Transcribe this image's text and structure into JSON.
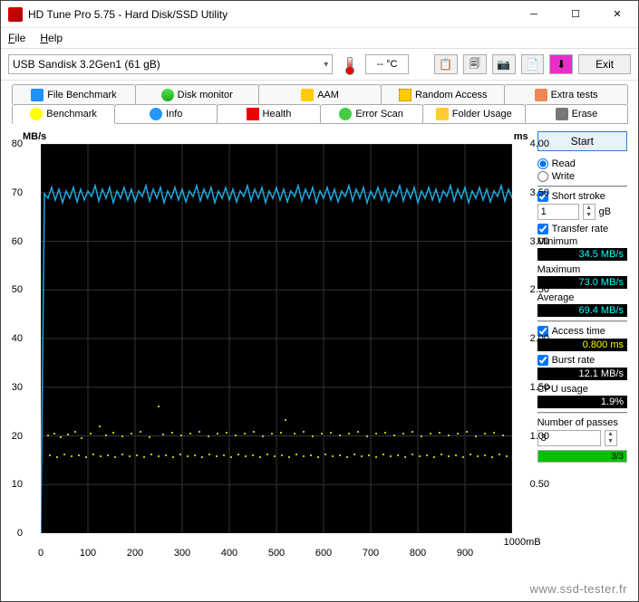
{
  "window": {
    "title": "HD Tune Pro 5.75 - Hard Disk/SSD Utility",
    "menus": [
      "File",
      "Help"
    ]
  },
  "toolbar": {
    "device": "USB Sandisk 3.2Gen1 (61 gB)",
    "temp": "-- °C",
    "exit": "Exit"
  },
  "tabs_top": [
    {
      "label": "File Benchmark"
    },
    {
      "label": "Disk monitor"
    },
    {
      "label": "AAM"
    },
    {
      "label": "Random Access"
    },
    {
      "label": "Extra tests"
    }
  ],
  "tabs_bottom": [
    {
      "label": "Benchmark"
    },
    {
      "label": "Info"
    },
    {
      "label": "Health"
    },
    {
      "label": "Error Scan"
    },
    {
      "label": "Folder Usage"
    },
    {
      "label": "Erase"
    }
  ],
  "chart_data": {
    "type": "line",
    "y_left": {
      "label": "MB/s",
      "min": 0,
      "max": 80,
      "ticks": [
        0,
        10,
        20,
        30,
        40,
        50,
        60,
        70,
        80
      ]
    },
    "y_right": {
      "label": "ms",
      "min": 0,
      "max": 4.0,
      "ticks": [
        "0.50",
        "1.00",
        "1.50",
        "2.00",
        "2.50",
        "3.00",
        "3.50",
        "4.00"
      ]
    },
    "x": {
      "min": 0,
      "max": 1000,
      "ticks": [
        0,
        100,
        200,
        300,
        400,
        500,
        600,
        700,
        800,
        900
      ],
      "unit": "mB"
    },
    "series": [
      {
        "name": "Transfer rate",
        "color": "#1ea8e0",
        "mean": 69.4,
        "min": 34.5,
        "max": 73.0,
        "notes": "oscillates ~67–73 MB/s with initial dip"
      },
      {
        "name": "Access time band 1",
        "color": "#ffff00",
        "approx_ms": 1.0,
        "style": "scatter"
      },
      {
        "name": "Access time band 2",
        "color": "#ffff00",
        "approx_ms": 0.8,
        "style": "scatter"
      }
    ]
  },
  "side": {
    "start": "Start",
    "read": "Read",
    "write": "Write",
    "short_stroke_label": "Short stroke",
    "short_stroke_value": "1",
    "short_stroke_unit": "gB",
    "transfer_rate_label": "Transfer rate",
    "minimum_label": "Minimum",
    "minimum_value": "34.5 MB/s",
    "maximum_label": "Maximum",
    "maximum_value": "73.0 MB/s",
    "average_label": "Average",
    "average_value": "69.4 MB/s",
    "access_time_label": "Access time",
    "access_time_value": "0.800 ms",
    "burst_rate_label": "Burst rate",
    "burst_rate_value": "12.1 MB/s",
    "cpu_usage_label": "CPU usage",
    "cpu_usage_value": "1.9%",
    "passes_label": "Number of passes",
    "passes_value": "3",
    "passes_progress": "3/3"
  },
  "watermark": "www.ssd-tester.fr"
}
